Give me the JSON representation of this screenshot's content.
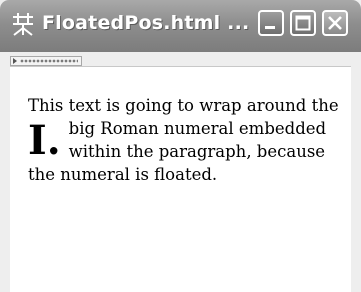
{
  "window": {
    "title": "FloatedPos.html ...",
    "icon": "browser-app-icon"
  },
  "controls": {
    "minimize_icon": "minimize-icon",
    "maximize_icon": "maximize-icon",
    "close_icon": "close-icon"
  },
  "content": {
    "text_before": "This text is going to wrap around the big Roman numeral",
    "numeral": "I.",
    "text_after": "embedded within the paragraph, because the numeral is floated."
  },
  "colors": {
    "titlebar": "#8e8e8e",
    "title_text": "#ffffff",
    "page_background": "#ffffff",
    "text": "#000000"
  }
}
